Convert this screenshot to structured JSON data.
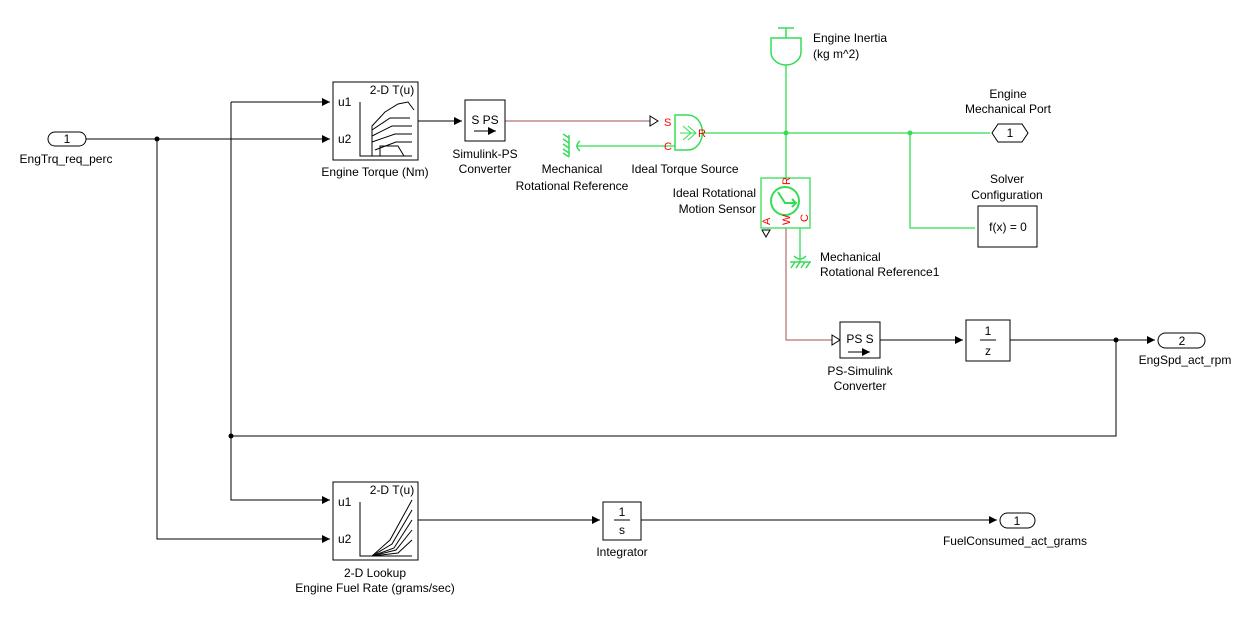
{
  "colors": {
    "signal": "#000000",
    "physical_signal": "#a05050",
    "mechanical": "#33dd55",
    "port_label": "#ff0000"
  },
  "inports": [
    {
      "number": "1",
      "name": "EngTrq_req_perc"
    }
  ],
  "outports": [
    {
      "number": "1",
      "name": "Engine",
      "name2": "Mechanical Port"
    },
    {
      "number": "2",
      "name": "EngSpd_act_rpm"
    },
    {
      "number": "1",
      "name": "FuelConsumed_act_grams"
    }
  ],
  "blocks": {
    "engine_torque": {
      "title": "2-D T(u)",
      "in1": "u1",
      "in2": "u2",
      "name": "Engine Torque (Nm)"
    },
    "fuel_rate": {
      "title": "2-D T(u)",
      "in1": "u1",
      "in2": "u2",
      "name1": "2-D Lookup",
      "name2": "Engine Fuel Rate (grams/sec)"
    },
    "sl_ps": {
      "text": "S PS",
      "name1": "Simulink-PS",
      "name2": "Converter"
    },
    "ps_sl": {
      "text": "PS S",
      "name1": "PS-Simulink",
      "name2": "Converter"
    },
    "mech_ref": {
      "name1": "Mechanical",
      "name2": "Rotational Reference"
    },
    "mech_ref1": {
      "name1": "Mechanical",
      "name2": "Rotational Reference1"
    },
    "torque_source": {
      "name": "Ideal Torque Source",
      "port_s": "S",
      "port_c": "C",
      "port_r": "R"
    },
    "inertia": {
      "name1": "Engine Inertia",
      "name2": "(kg m^2)"
    },
    "sensor": {
      "name1": "Ideal Rotational",
      "name2": "Motion Sensor",
      "port_r": "R",
      "port_a": "A",
      "port_w": "W",
      "port_c": "C"
    },
    "solver": {
      "text": "f(x) = 0",
      "name1": "Solver",
      "name2": "Configuration"
    },
    "unit_delay": {
      "num": "1",
      "den": "z"
    },
    "integrator": {
      "num": "1",
      "den": "s",
      "name": "Integrator"
    }
  }
}
